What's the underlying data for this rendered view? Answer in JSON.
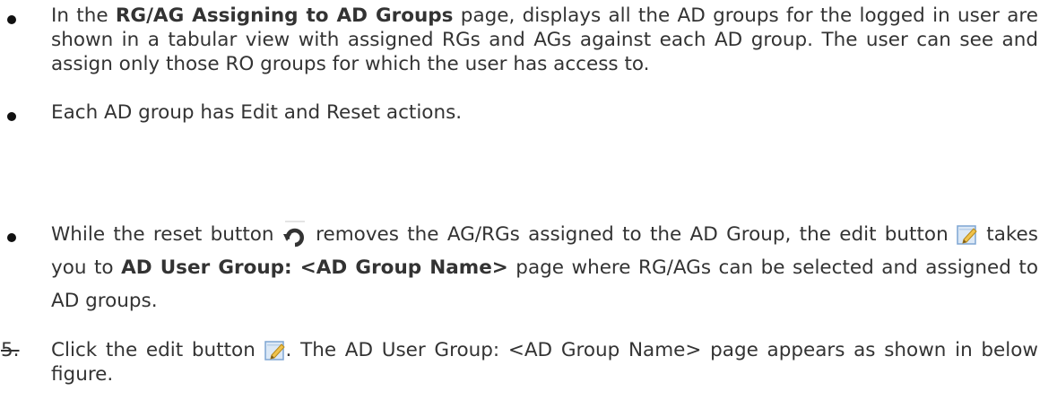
{
  "items": [
    {
      "type": "bullet",
      "pre": "In the ",
      "bold": "RG/AG Assigning to AD Groups",
      "post": " page, displays all the AD groups for the logged in user are shown in a tabular view with assigned RGs and AGs against each AD group. The user can see and assign only those RO groups for which the user has access to."
    },
    {
      "type": "bullet",
      "text": "Each AD group has Edit and Reset actions."
    },
    {
      "type": "bullet",
      "pre": "While the reset button ",
      "icon1": "reset-icon",
      "mid1": " removes the AG/RGs assigned to the AD Group, the edit button ",
      "icon2": "edit-icon",
      "mid2": " takes you to ",
      "bold": "AD User Group: <AD Group Name>",
      "post": " page where RG/AGs can be selected and assigned to AD groups."
    },
    {
      "type": "numbered",
      "number": "5.",
      "pre": "Click the edit button ",
      "icon": "edit-icon",
      "post": ". The AD User Group: <AD Group Name> page appears as shown in below figure."
    }
  ]
}
